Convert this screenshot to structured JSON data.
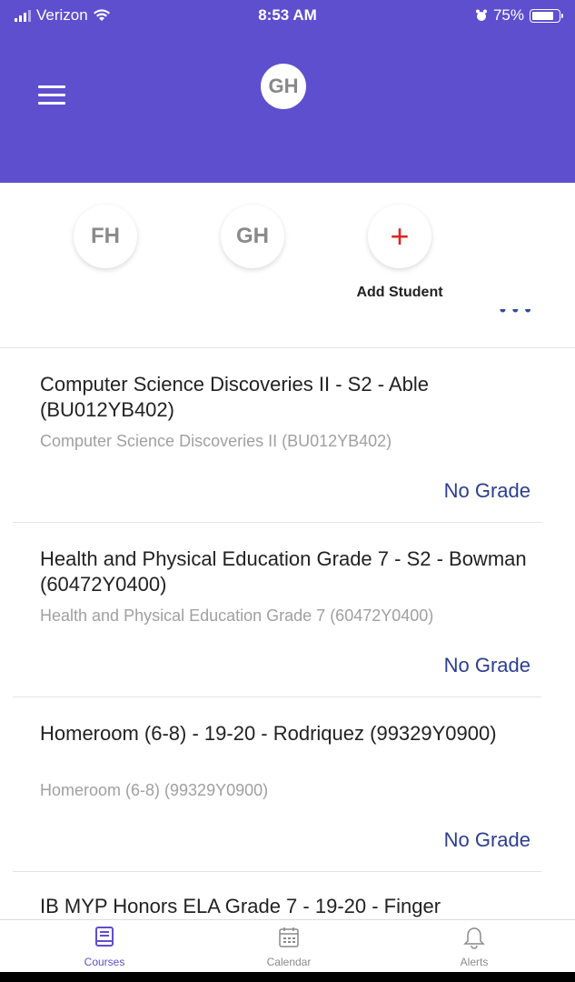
{
  "status_bar": {
    "carrier": "Verizon",
    "time": "8:53 AM",
    "battery": "75%"
  },
  "header": {
    "avatar_initials": "GH"
  },
  "students": [
    {
      "initials": "FH"
    },
    {
      "initials": "GH"
    }
  ],
  "add_student": {
    "icon": "+",
    "label": "Add Student"
  },
  "courses": [
    {
      "title": "Computer Science Discoveries II - S2 - Able (BU012YB402)",
      "subtitle": "Computer Science Discoveries II (BU012YB402)",
      "grade": "No Grade"
    },
    {
      "title": "Health and Physical Education  Grade 7 - S2 - Bowman (60472Y0400)",
      "subtitle": "Health and Physical Education  Grade 7 (60472Y0400)",
      "grade": "No Grade"
    },
    {
      "title": "Homeroom (6-8) - 19-20 - Rodriquez (99329Y0900)",
      "subtitle": "Homeroom (6-8) (99329Y0900)",
      "grade": "No Grade"
    },
    {
      "title": "IB MYP Honors ELA Grade 7 - 19-20 - Finger"
    }
  ],
  "tabs": [
    {
      "label": "Courses",
      "icon": "book-icon"
    },
    {
      "label": "Calendar",
      "icon": "calendar-icon"
    },
    {
      "label": "Alerts",
      "icon": "bell-icon"
    }
  ],
  "colors": {
    "brand": "#5e4fce",
    "grade": "#2c3e8f",
    "add": "#e02424"
  }
}
